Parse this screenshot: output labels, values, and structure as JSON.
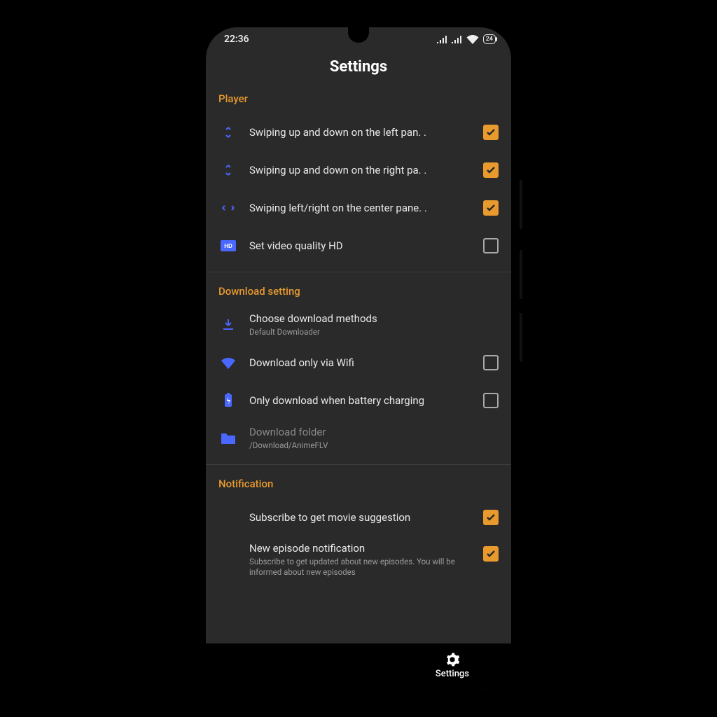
{
  "status": {
    "time": "22:36",
    "battery": "24"
  },
  "title": "Settings",
  "sections": [
    {
      "header": "Player",
      "items": [
        {
          "icon": "swipe-v",
          "label": "Swiping up and down on the left pan. .",
          "checked": true
        },
        {
          "icon": "swipe-v",
          "label": "Swiping up and down on the right pa. .",
          "checked": true
        },
        {
          "icon": "swipe-h",
          "label": "Swiping left/right on the center pane. .",
          "checked": true
        },
        {
          "icon": "hd",
          "label": "Set video quality HD",
          "checked": false
        }
      ]
    },
    {
      "header": "Download setting",
      "items": [
        {
          "icon": "download",
          "label": "Choose download methods",
          "sub": "Default Downloader"
        },
        {
          "icon": "wifi",
          "label": "Download only via Wifi",
          "checked": false
        },
        {
          "icon": "battery",
          "label": "Only download when battery charging",
          "checked": false
        },
        {
          "icon": "folder",
          "label": "Download folder",
          "sub": "/Download/AnimeFLV",
          "disabled": true
        }
      ]
    },
    {
      "header": "Notification",
      "items": [
        {
          "icon": "",
          "label": "Subscribe to get movie suggestion",
          "checked": true
        },
        {
          "icon": "",
          "label": "New episode notification",
          "sub": "Subscribe to get updated about new episodes. You will be informed about new episodes",
          "checked": true
        }
      ]
    }
  ],
  "bottomnav": {
    "settings": "Settings"
  }
}
